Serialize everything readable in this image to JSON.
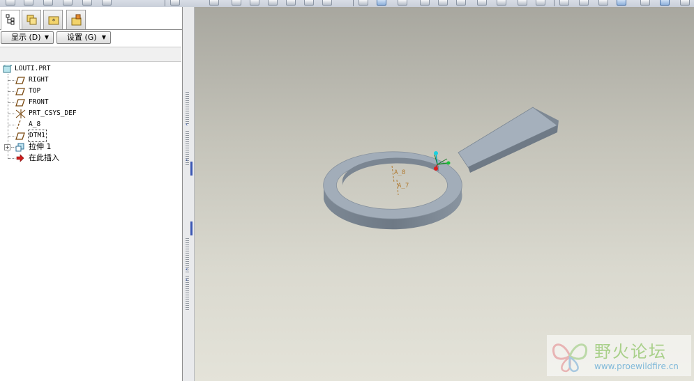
{
  "model_tree": {
    "display_button": "显示 (D)",
    "settings_button": "设置 (G)",
    "root": "LOUTI.PRT",
    "items": [
      {
        "label": "RIGHT",
        "icon": "datum-plane-icon"
      },
      {
        "label": "TOP",
        "icon": "datum-plane-icon"
      },
      {
        "label": "FRONT",
        "icon": "datum-plane-icon"
      },
      {
        "label": "PRT_CSYS_DEF",
        "icon": "csys-icon"
      },
      {
        "label": "A_8",
        "icon": "datum-axis-icon"
      },
      {
        "label": "DTM1",
        "icon": "datum-plane-icon"
      },
      {
        "label": "拉伸 1",
        "icon": "extrude-icon"
      },
      {
        "label": "在此插入",
        "icon": "insert-here-arrow-icon"
      }
    ]
  },
  "viewport": {
    "axis_labels": [
      "A_8",
      "A_7"
    ],
    "colors": {
      "model_face": "#9aa6b2",
      "model_side": "#76828e",
      "axis_label": "#b07a30"
    }
  },
  "watermark": {
    "title": "野火论坛",
    "url": "www.proewildfire.cn"
  }
}
